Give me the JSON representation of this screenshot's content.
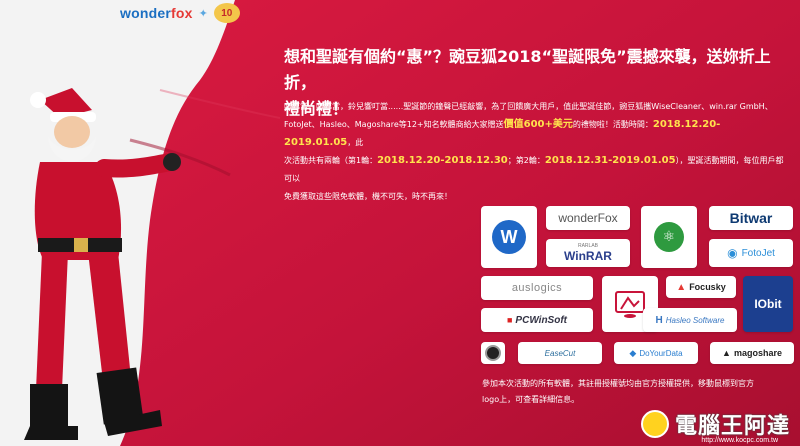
{
  "header": {
    "brand_prefix": "wonder",
    "brand_suffix": "fox",
    "badge": "10"
  },
  "headline": {
    "line1": "想和聖誕有個約“惠”？豌豆狐2018“聖誕限免”震撼來襲，送妳折上折，",
    "line2": "禮尚禮！"
  },
  "intro": {
    "p1": "叮叮當，叮叮當，鈴兒響叮當......聖誕節的鐘聲已經敲響，為了回饋廣大用戶，值此聖誕佳節，豌豆狐攜WiseCleaner、win.rar GmbH、",
    "p2a": "FotoJet、Hasleo、Magoshare等12+知名軟體商給大家贈送",
    "p2b": "價值600+美元",
    "p2c": "的禮物啦！活動時間：",
    "p2d": "2018.12.20-2019.01.05",
    "p2e": "，此",
    "p3a": "次活動共有兩輪（第1輪：",
    "p3b": "2018.12.20-2018.12.30",
    "p3c": "；第2輪：",
    "p3d": "2018.12.31-2019.01.05",
    "p3e": "），聖誕活動期間，每位用戶都可以",
    "p4": "免費獲取這些限免軟體，機不可失，時不再來！"
  },
  "logos": {
    "wondershare_w": "W",
    "wonderfox": "wonderFox",
    "winrar_small": "RARLAB",
    "winrar": "WinRAR",
    "bitwar": "Bitwar",
    "fotojet": "FotoJet",
    "auslogics": "auslogics",
    "focusky": "Focusky",
    "iobit": "IObit",
    "pcwinsoft": "PCWinSoft",
    "hasleo": "Hasleo Software",
    "easycut": "EaseCut",
    "doyourdata": "DoYourData",
    "magoshare": "magoshare"
  },
  "footer": {
    "line1": "參加本次活動的所有軟體，其註冊授權號均由官方授權提供，移動鼠標到官方",
    "line2": "logo上，可查看詳細信息。"
  },
  "watermark": {
    "text": "電腦王阿達",
    "url": "http://www.kocpc.com.tw"
  },
  "colors": {
    "drape": "#c8143a",
    "highlight": "#ffe34d",
    "brand_blue": "#1b6fc2"
  }
}
